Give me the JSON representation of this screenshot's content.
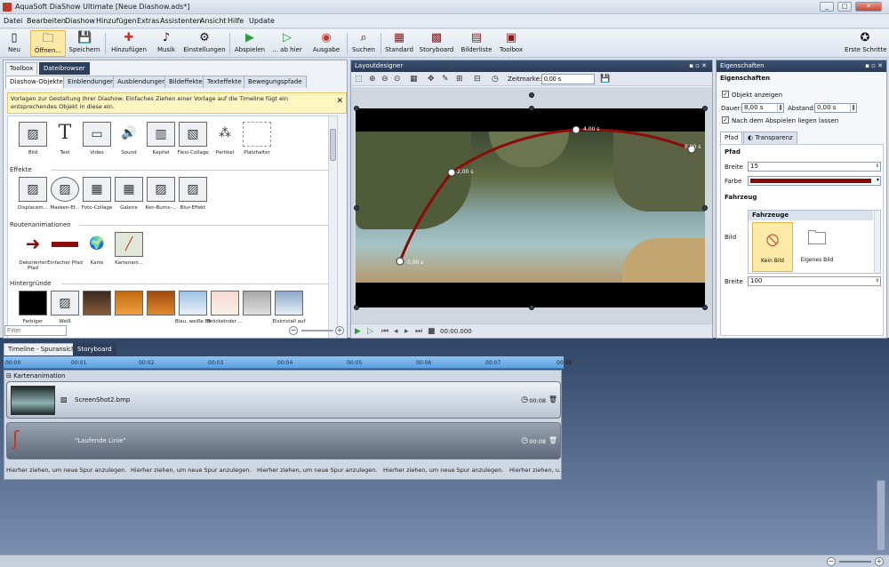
{
  "window": {
    "title": "AquaSoft DiaShow Ultimate [Neue Diashow.ads*]",
    "controls": [
      "_",
      "□",
      "✕"
    ]
  },
  "menu": [
    "Datei",
    "Bearbeiten",
    "Diashow",
    "Hinzufügen",
    "Extras",
    "Assistenten",
    "Ansicht",
    "Hilfe",
    "Update"
  ],
  "toolbar": {
    "neu": "Neu",
    "oeffnen": "Öffnen...",
    "speichern": "Speichern",
    "hinzufuegen": "Hinzufügen",
    "musik": "Musik",
    "einstellungen": "Einstellungen",
    "abspielen": "Abspielen",
    "ab_hier": "... ab hier",
    "ausgabe": "Ausgabe",
    "suchen": "Suchen",
    "standard": "Standard",
    "storyboard": "Storyboard",
    "bilderliste": "Bilderliste",
    "toolbox": "Toolbox",
    "erste_schritte": "Erste Schritte"
  },
  "toolbox": {
    "top_tabs": [
      "Toolbox",
      "Dateibrowser"
    ],
    "tabs": [
      "Diashow-Objekte",
      "Einblendungen",
      "Ausblendungen",
      "Bildeffekte",
      "Texteffekte",
      "Bewegungspfade"
    ],
    "hint": "Vorlagen zur Gestaltung Ihrer Diashow: Einfaches Ziehen einer Vorlage auf die Timeline fügt ein entsprechendes Objekt in diese ein.",
    "objects": [
      "Bild",
      "Text",
      "Video",
      "Sound",
      "Kapitel",
      "Flexi-Collage",
      "Partikel",
      "Platzhalter"
    ],
    "effekte_title": "Effekte",
    "effekte": [
      "Displacem...",
      "Masken-Ef...",
      "Foto-Collage",
      "Galerie",
      "Ken-Burns-...",
      "Blur-Effekt"
    ],
    "routen_title": "Routenanimationen",
    "routen": [
      "Dekorierter Pfad",
      "Einfacher Pfad",
      "Karte",
      "Kartenani..."
    ],
    "hintergruende_title": "Hintergründe",
    "hintergruende": [
      "Farbiger",
      "Weiß",
      "",
      "",
      "",
      "Blau, weiße Blumenvase...",
      "Bröckelnder ...",
      "",
      "Eiskristall auf"
    ],
    "filter_placeholder": "Filter"
  },
  "layout": {
    "title": "Layoutdesigner",
    "zeitmarke_label": "Zeitmarke:",
    "zeitmarke_value": "0,00 s",
    "waypoints": [
      "0,00 s",
      "2,00 s",
      "4,00 s",
      "6,00 s"
    ],
    "player_time": "00:00.000"
  },
  "props": {
    "title": "Eigenschaften",
    "section": "Eigenschaften",
    "objekt_anzeigen": "Objekt anzeigen",
    "dauer_label": "Dauer:",
    "dauer_value": "8,00 s",
    "abstand_label": "Abstand:",
    "abstand_value": "0,00 s",
    "nach_abspielen": "Nach dem Abspielen liegen lassen",
    "tabs": [
      "Pfad",
      "Transparenz"
    ],
    "pfad_title": "Pfad",
    "breite_label": "Breite",
    "breite_value": "15",
    "farbe_label": "Farbe",
    "farbe_value": "#8b0a0a",
    "fahrzeug_title": "Fahrzeug",
    "bild_label": "Bild",
    "fahrzeuge_head": "Fahrzeuge",
    "kein_bild": "Kein Bild",
    "eigenes_bild": "Eigenes Bild",
    "breite2_label": "Breite",
    "breite2_value": "100"
  },
  "timeline": {
    "tabs": [
      "Timeline - Spuransicht",
      "Storyboard"
    ],
    "ruler": [
      "00:00",
      "00:01",
      "00:02",
      "00:03",
      "00:04",
      "00:05",
      "00:06",
      "00:07",
      "00:08"
    ],
    "group": "Kartenanimation",
    "track1_name": "ScreenShot2.bmp",
    "track1_time": "00:08",
    "track2_name": "\"Laufende Linie\"",
    "track2_time": "00:08",
    "drop_hints": [
      "Hierher ziehen, um neue Spur anzulegen.",
      "Hierher ziehen, um neue Spur anzulegen.",
      "Hierher ziehen, um neue Spur anzulegen.",
      "Hierher ziehen, um neue Spur anzulegen.",
      "Hierher ziehen, um neue Spur anzulegen.",
      "Hierher ziehen, u..."
    ]
  },
  "colors": {
    "path": "#8b0a0a",
    "accent": "#fde9a8",
    "panel_header": "#2d3f5b"
  }
}
